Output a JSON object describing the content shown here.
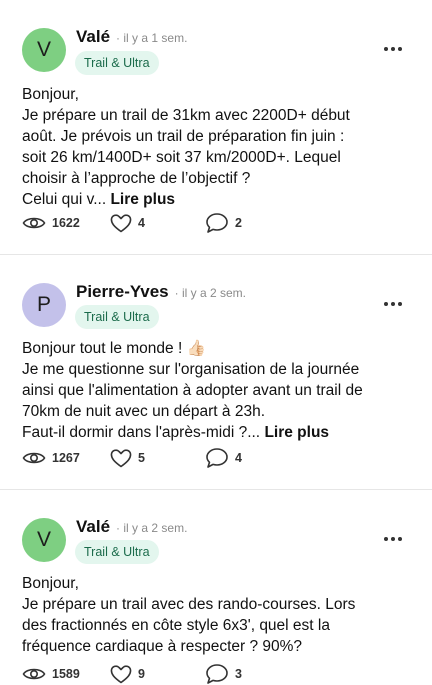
{
  "posts": [
    {
      "avatar_letter": "V",
      "avatar_color": "#7ecf82",
      "author": "Valé",
      "time": "· il y a 1 sem.",
      "tag": "Trail & Ultra",
      "lines": [
        "Bonjour,",
        "Je prépare un trail de 31km avec 2200D+ début",
        "août. Je prévois un trail de préparation fin juin :",
        "soit 26 km/1400D+ soit 37 km/2000D+. Lequel",
        "choisir à l’approche de l’objectif ?"
      ],
      "last_line": "Celui qui v...",
      "read_more": "Lire plus",
      "views": "1622",
      "likes": "4",
      "comments": "2"
    },
    {
      "avatar_letter": "P",
      "avatar_color": "#c3c1ea",
      "author": "Pierre-Yves",
      "time": "· il y a 2 sem.",
      "tag": "Trail & Ultra",
      "lines": [
        "Bonjour tout le monde ! 👍🏻",
        "Je me questionne sur l'organisation de la journée",
        "ainsi que l'alimentation à adopter avant un trail de",
        "70km de nuit avec un départ à 23h."
      ],
      "last_line": "Faut-il dormir dans l'après-midi ?...",
      "read_more": "Lire plus",
      "views": "1267",
      "likes": "5",
      "comments": "4"
    },
    {
      "avatar_letter": "V",
      "avatar_color": "#7ecf82",
      "author": "Valé",
      "time": "· il y a 2 sem.",
      "tag": "Trail & Ultra",
      "lines": [
        "Bonjour,",
        "Je prépare un trail avec des rando-courses. Lors",
        "des fractionnés en côte style 6x3', quel est la",
        "fréquence cardiaque à respecter ? 90%?"
      ],
      "views": "1589",
      "likes": "9",
      "comments": "3"
    }
  ],
  "icons": {
    "views": "eye-icon",
    "likes": "heart-icon",
    "comments": "comment-icon",
    "more": "more-icon"
  }
}
